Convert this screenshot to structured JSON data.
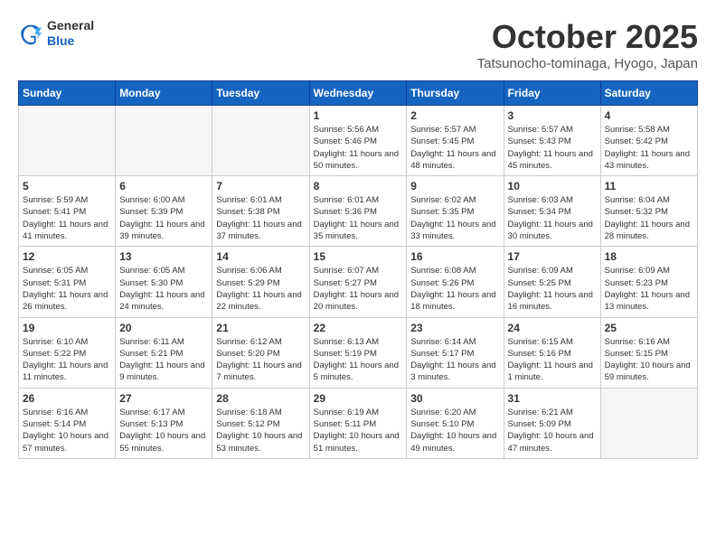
{
  "header": {
    "logo": {
      "line1": "General",
      "line2": "Blue"
    },
    "title": "October 2025",
    "location": "Tatsunocho-tominaga, Hyogo, Japan"
  },
  "days_of_week": [
    "Sunday",
    "Monday",
    "Tuesday",
    "Wednesday",
    "Thursday",
    "Friday",
    "Saturday"
  ],
  "weeks": [
    {
      "cells": [
        {
          "empty": true
        },
        {
          "empty": true
        },
        {
          "empty": true
        },
        {
          "day": 1,
          "sunrise": "5:56 AM",
          "sunset": "5:46 PM",
          "daylight": "11 hours and 50 minutes."
        },
        {
          "day": 2,
          "sunrise": "5:57 AM",
          "sunset": "5:45 PM",
          "daylight": "11 hours and 48 minutes."
        },
        {
          "day": 3,
          "sunrise": "5:57 AM",
          "sunset": "5:43 PM",
          "daylight": "11 hours and 45 minutes."
        },
        {
          "day": 4,
          "sunrise": "5:58 AM",
          "sunset": "5:42 PM",
          "daylight": "11 hours and 43 minutes."
        }
      ]
    },
    {
      "cells": [
        {
          "day": 5,
          "sunrise": "5:59 AM",
          "sunset": "5:41 PM",
          "daylight": "11 hours and 41 minutes."
        },
        {
          "day": 6,
          "sunrise": "6:00 AM",
          "sunset": "5:39 PM",
          "daylight": "11 hours and 39 minutes."
        },
        {
          "day": 7,
          "sunrise": "6:01 AM",
          "sunset": "5:38 PM",
          "daylight": "11 hours and 37 minutes."
        },
        {
          "day": 8,
          "sunrise": "6:01 AM",
          "sunset": "5:36 PM",
          "daylight": "11 hours and 35 minutes."
        },
        {
          "day": 9,
          "sunrise": "6:02 AM",
          "sunset": "5:35 PM",
          "daylight": "11 hours and 33 minutes."
        },
        {
          "day": 10,
          "sunrise": "6:03 AM",
          "sunset": "5:34 PM",
          "daylight": "11 hours and 30 minutes."
        },
        {
          "day": 11,
          "sunrise": "6:04 AM",
          "sunset": "5:32 PM",
          "daylight": "11 hours and 28 minutes."
        }
      ]
    },
    {
      "cells": [
        {
          "day": 12,
          "sunrise": "6:05 AM",
          "sunset": "5:31 PM",
          "daylight": "11 hours and 26 minutes."
        },
        {
          "day": 13,
          "sunrise": "6:05 AM",
          "sunset": "5:30 PM",
          "daylight": "11 hours and 24 minutes."
        },
        {
          "day": 14,
          "sunrise": "6:06 AM",
          "sunset": "5:29 PM",
          "daylight": "11 hours and 22 minutes."
        },
        {
          "day": 15,
          "sunrise": "6:07 AM",
          "sunset": "5:27 PM",
          "daylight": "11 hours and 20 minutes."
        },
        {
          "day": 16,
          "sunrise": "6:08 AM",
          "sunset": "5:26 PM",
          "daylight": "11 hours and 18 minutes."
        },
        {
          "day": 17,
          "sunrise": "6:09 AM",
          "sunset": "5:25 PM",
          "daylight": "11 hours and 16 minutes."
        },
        {
          "day": 18,
          "sunrise": "6:09 AM",
          "sunset": "5:23 PM",
          "daylight": "11 hours and 13 minutes."
        }
      ]
    },
    {
      "cells": [
        {
          "day": 19,
          "sunrise": "6:10 AM",
          "sunset": "5:22 PM",
          "daylight": "11 hours and 11 minutes."
        },
        {
          "day": 20,
          "sunrise": "6:11 AM",
          "sunset": "5:21 PM",
          "daylight": "11 hours and 9 minutes."
        },
        {
          "day": 21,
          "sunrise": "6:12 AM",
          "sunset": "5:20 PM",
          "daylight": "11 hours and 7 minutes."
        },
        {
          "day": 22,
          "sunrise": "6:13 AM",
          "sunset": "5:19 PM",
          "daylight": "11 hours and 5 minutes."
        },
        {
          "day": 23,
          "sunrise": "6:14 AM",
          "sunset": "5:17 PM",
          "daylight": "11 hours and 3 minutes."
        },
        {
          "day": 24,
          "sunrise": "6:15 AM",
          "sunset": "5:16 PM",
          "daylight": "11 hours and 1 minute."
        },
        {
          "day": 25,
          "sunrise": "6:16 AM",
          "sunset": "5:15 PM",
          "daylight": "10 hours and 59 minutes."
        }
      ]
    },
    {
      "cells": [
        {
          "day": 26,
          "sunrise": "6:16 AM",
          "sunset": "5:14 PM",
          "daylight": "10 hours and 57 minutes."
        },
        {
          "day": 27,
          "sunrise": "6:17 AM",
          "sunset": "5:13 PM",
          "daylight": "10 hours and 55 minutes."
        },
        {
          "day": 28,
          "sunrise": "6:18 AM",
          "sunset": "5:12 PM",
          "daylight": "10 hours and 53 minutes."
        },
        {
          "day": 29,
          "sunrise": "6:19 AM",
          "sunset": "5:11 PM",
          "daylight": "10 hours and 51 minutes."
        },
        {
          "day": 30,
          "sunrise": "6:20 AM",
          "sunset": "5:10 PM",
          "daylight": "10 hours and 49 minutes."
        },
        {
          "day": 31,
          "sunrise": "6:21 AM",
          "sunset": "5:09 PM",
          "daylight": "10 hours and 47 minutes."
        },
        {
          "empty": true
        }
      ]
    }
  ]
}
